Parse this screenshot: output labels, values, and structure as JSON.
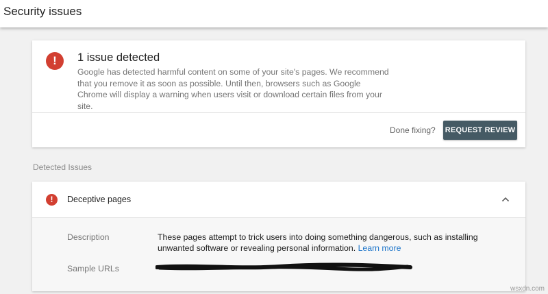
{
  "header": {
    "title": "Security issues"
  },
  "summary": {
    "icon": "error-icon",
    "heading": "1 issue detected",
    "description": "Google has detected harmful content on some of your site's pages. We recommend that you remove it as soon as possible. Until then, browsers such as Google Chrome will display a warning when users visit or download certain files from your site.",
    "done_label": "Done fixing?",
    "request_review_label": "REQUEST REVIEW"
  },
  "detected": {
    "section_label": "Detected Issues",
    "issues": [
      {
        "title": "Deceptive pages",
        "icon": "error-icon",
        "expanded": true,
        "description_label": "Description",
        "description_text": "These pages attempt to trick users into doing something dangerous, such as installing unwanted software or revealing personal information.",
        "learn_more_label": "Learn more",
        "sample_urls_label": "Sample URLs"
      }
    ]
  },
  "watermark": "wsxdn.com",
  "colors": {
    "error_red": "#d23f31",
    "button_bg": "#455a64",
    "link_blue": "#1a73c9",
    "page_bg": "#f1f1f1"
  }
}
